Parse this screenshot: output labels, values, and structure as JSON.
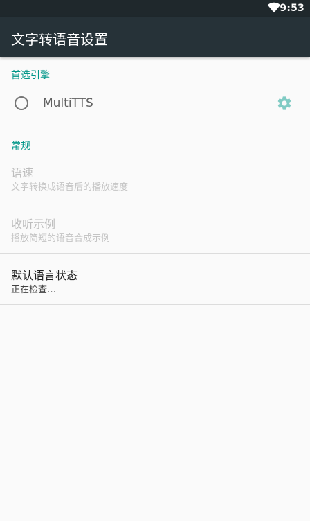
{
  "status_bar": {
    "time": "9:53",
    "icons": [
      "wifi-icon"
    ]
  },
  "app_bar": {
    "title": "文字转语音设置",
    "color": "#263238"
  },
  "engine_section": {
    "header": "首选引擎",
    "engines": [
      {
        "name": "MultiTTS",
        "selected": false,
        "settings_icon": "gear-icon"
      }
    ]
  },
  "general_section": {
    "header": "常规",
    "items": [
      {
        "title": "语速",
        "summary": "文字转换成语音后的播放速度",
        "enabled": false
      },
      {
        "title": "收听示例",
        "summary": "播放简短的语音合成示例",
        "enabled": false
      },
      {
        "title": "默认语言状态",
        "summary": "正在检查…",
        "enabled": true
      }
    ]
  },
  "colors": {
    "accent": "#009688",
    "background": "#fafafa",
    "status_bar": "#1f282c"
  }
}
